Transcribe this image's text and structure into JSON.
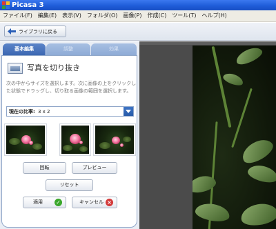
{
  "window": {
    "title": "Picasa 3"
  },
  "menu": [
    "ファイル(F)",
    "編集(E)",
    "表示(V)",
    "フォルダ(O)",
    "画像(P)",
    "作成(C)",
    "ツール(T)",
    "ヘルプ(H)"
  ],
  "toolbar": {
    "back_label": "ライブラリに戻る"
  },
  "tabs": {
    "basic": "基本編集",
    "tuning": "調整",
    "effects": "効果"
  },
  "crop": {
    "title": "写真を切り抜き",
    "description": "次の中からサイズを選択します。次に画像の上をクリックした状態でドラッグし、切り取る画像の範囲を選択します。",
    "ratio_label": "現在の比率:",
    "ratio_value": "3 x 2"
  },
  "buttons": {
    "rotate": "回転",
    "preview": "プレビュー",
    "reset": "リセット",
    "apply": "適用",
    "cancel": "キャンセル"
  },
  "colors": {
    "titlebar": "#1f5dd9",
    "tab_active": "#3c67b2",
    "apply_icon": "#3aa72b",
    "cancel_icon": "#d33a3a",
    "viewer_background": "#4b4b4b"
  }
}
